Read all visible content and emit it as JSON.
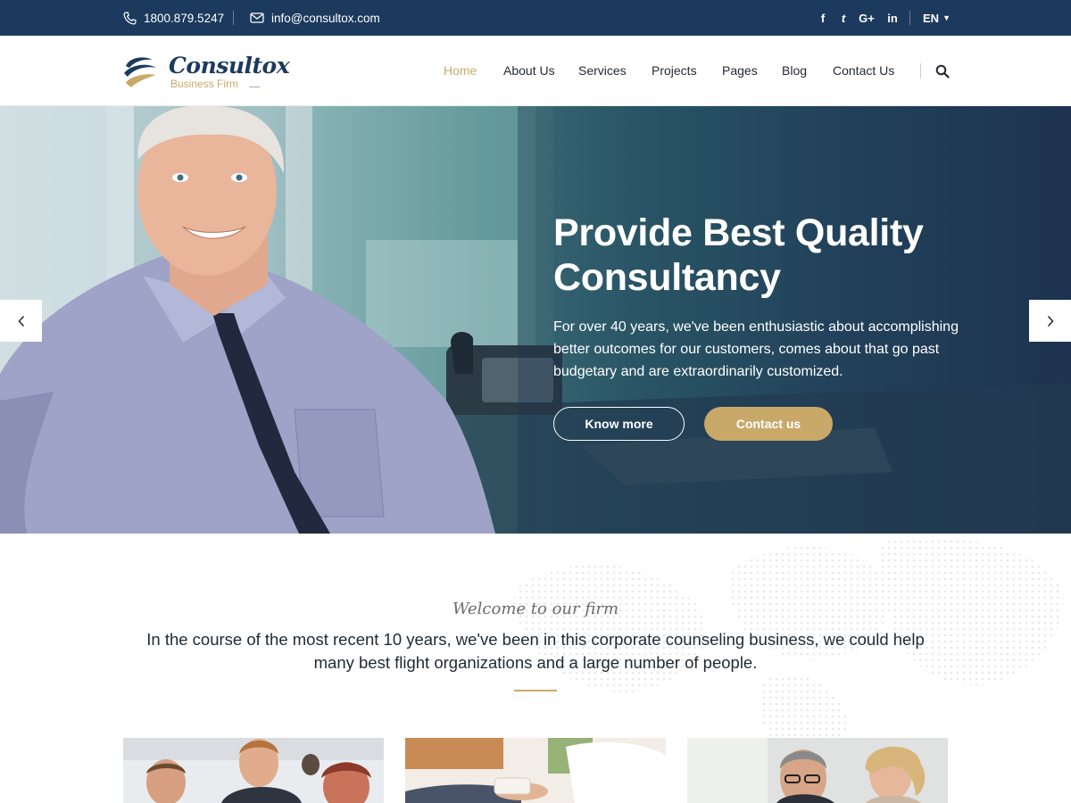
{
  "topbar": {
    "phone": "1800.879.5247",
    "email": "info@consultox.com",
    "phone_icon": "phone-icon",
    "email_icon": "envelope-icon",
    "social": [
      {
        "icon": "facebook-icon",
        "glyph": "f"
      },
      {
        "icon": "twitter-icon",
        "glyph": "t"
      },
      {
        "icon": "google-plus-icon",
        "glyph": "G+"
      },
      {
        "icon": "linkedin-icon",
        "glyph": "in"
      }
    ],
    "language": "EN",
    "language_caret": "▼"
  },
  "header": {
    "logo_name": "Consultox",
    "logo_tagline": "Business Firm",
    "nav": [
      {
        "label": "Home",
        "active": true
      },
      {
        "label": "About Us"
      },
      {
        "label": "Services"
      },
      {
        "label": "Projects"
      },
      {
        "label": "Pages"
      },
      {
        "label": "Blog"
      },
      {
        "label": "Contact Us"
      }
    ],
    "search_icon": "search-icon"
  },
  "hero": {
    "title": "Provide Best Quality Consultancy",
    "text": "For over 40 years, we've been enthusiastic about accomplishing better outcomes for our customers, comes about that go past budgetary and are extraordinarily customized.",
    "primary_button": "Know more",
    "secondary_button": "Contact us",
    "prev_arrow": "‹",
    "next_arrow": "›"
  },
  "welcome": {
    "kicker": "Welcome to our firm",
    "lead": "In the course of the most recent 10 years, we've been in this corporate counseling business, we could help many best flight organizations and a large number of people."
  },
  "colors": {
    "topbar": "#1c3a5d",
    "accent_gold": "#c9a96a",
    "text_dark": "#1f2933"
  }
}
